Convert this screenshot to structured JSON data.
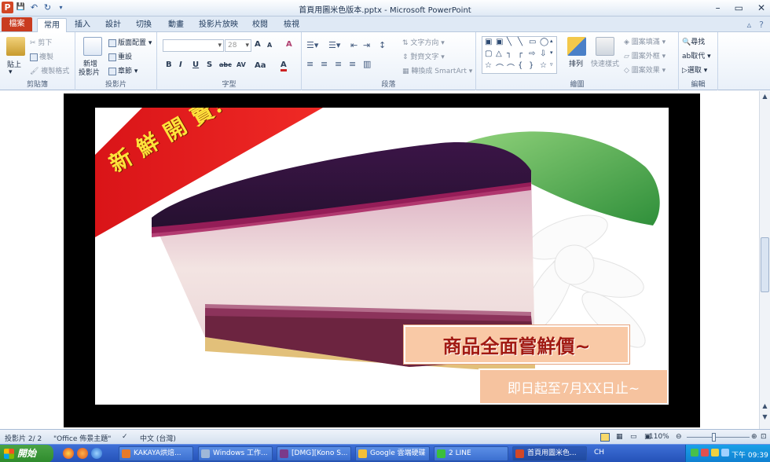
{
  "window": {
    "title": "首頁用圖米色版本.pptx  -  Microsoft PowerPoint",
    "minimize": "–",
    "maximize": "▭",
    "close": "✕"
  },
  "qat": {
    "logo": "P",
    "save": "💾",
    "undo": "↶",
    "redo": "↻",
    "more": "▾"
  },
  "tabs": {
    "file": "檔案",
    "items": [
      "常用",
      "插入",
      "設計",
      "切換",
      "動畫",
      "投影片放映",
      "校閱",
      "檢視"
    ],
    "right_icons": [
      "▵",
      "?"
    ]
  },
  "ribbon": {
    "clipboard": {
      "label": "剪貼簿",
      "paste": "貼上",
      "cut": "剪下",
      "copy": "複製",
      "format_painter": "複製格式"
    },
    "slides": {
      "label": "投影片",
      "new_slide": "新增",
      "new_slide2": "投影片",
      "layout": "版面配置",
      "reset": "重設",
      "section": "章節"
    },
    "font": {
      "label": "字型",
      "size": "28",
      "bold": "B",
      "italic": "I",
      "underline": "U",
      "shadow": "S",
      "strike": "abc",
      "spacing": "AV",
      "case": "Aa",
      "color": "A",
      "grow": "A",
      "shrink": "A",
      "clear": "A"
    },
    "paragraph": {
      "label": "段落",
      "text_direction": "文字方向",
      "align_text": "對齊文字",
      "smartart": "轉換成 SmartArt"
    },
    "drawing": {
      "label": "繪圖",
      "arrange": "排列",
      "quick_styles": "快速樣式",
      "shape_fill": "圖案填滿",
      "shape_outline": "圖案外框",
      "shape_effects": "圖案效果"
    },
    "editing": {
      "label": "編輯",
      "find": "尋找",
      "replace": "取代",
      "select": "選取"
    }
  },
  "slide": {
    "banner": "新 鮮 開 賣!!",
    "box1": "商品全面嘗鮮價~",
    "box2": "即日起至7月XX日止~"
  },
  "status": {
    "slide_num": "投影片 2/ 2",
    "theme": "\"Office 佈景主題\"",
    "lang": "中文 (台灣)",
    "zoom": "110%"
  },
  "taskbar": {
    "start": "開始",
    "tasks": [
      "KAKAYA烘焙...",
      "Windows 工作...",
      "[DMG][Kono S...",
      "Google 雲端硬碟",
      "2 LINE",
      "首頁用圖米色..."
    ],
    "lang": "CH",
    "clock": "下午 09:39"
  }
}
